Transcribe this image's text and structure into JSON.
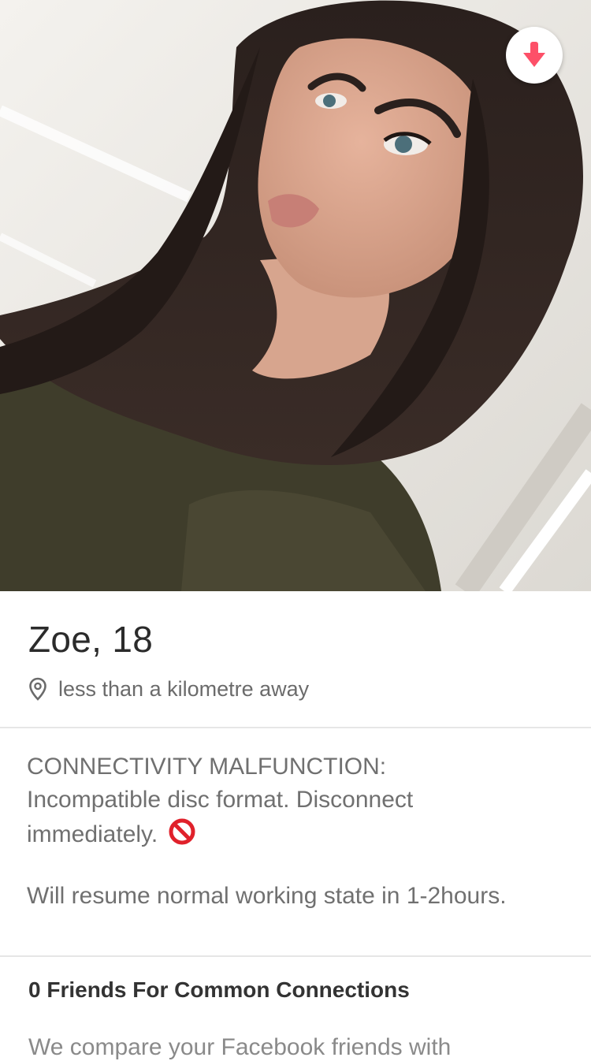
{
  "profile": {
    "name_age": "Zoe, 18",
    "distance": "less than a kilometre away"
  },
  "bio": {
    "line1": "CONNECTIVITY MALFUNCTION:",
    "line2": "Incompatible disc format. Disconnect",
    "line3": "immediately.",
    "line4": "Will resume normal working state in 1-2hours."
  },
  "common_connections": {
    "heading": "0 Friends For Common Connections",
    "description": "We compare your Facebook friends with"
  },
  "icons": {
    "collapse": "arrow-down-icon",
    "location": "location-pin-icon",
    "no_entry": "no-entry-emoji"
  },
  "colors": {
    "accent": "#fd5068",
    "text_primary": "#2b2b2b",
    "text_secondary": "#707070"
  }
}
